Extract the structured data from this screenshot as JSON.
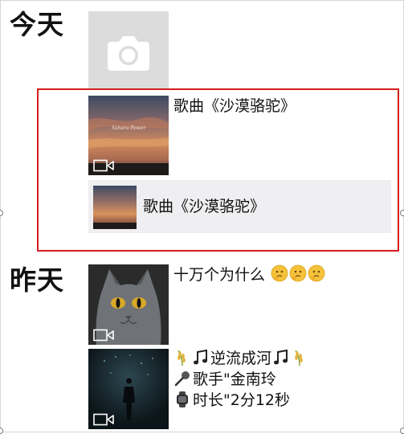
{
  "sections": [
    {
      "label": "今天"
    },
    {
      "label": "昨天"
    }
  ],
  "today": {
    "camera_tile": {
      "icon": "camera-icon"
    },
    "post": {
      "text": "歌曲《沙漠骆驼》",
      "share_card_text": "歌曲《沙漠骆驼》",
      "thumb_caption": "Sahara Power"
    }
  },
  "yesterday": {
    "post1": {
      "text": "十万个为什么"
    },
    "post2": {
      "line1": "逆流成河",
      "line2": "歌手\"金南玲",
      "line3": "时长\"2分12秒"
    }
  },
  "colors": {
    "highlight": "#d41d1d",
    "camera_bg": "#dcdcdc",
    "share_bg": "#efeff1"
  }
}
